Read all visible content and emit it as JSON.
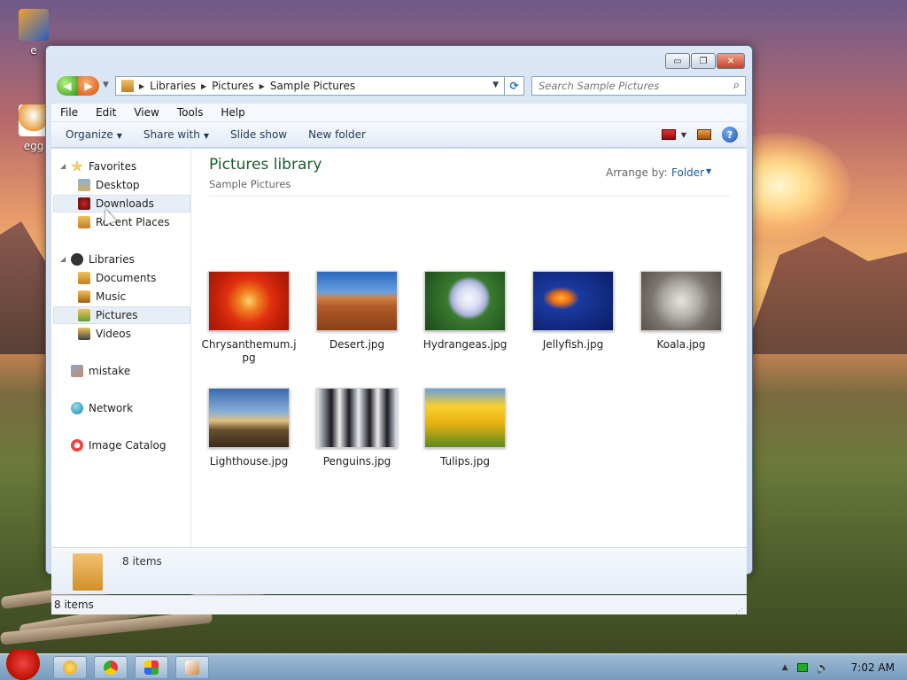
{
  "desktop": {
    "icons": [
      {
        "label": "e"
      },
      {
        "label": "egg"
      }
    ]
  },
  "window": {
    "controls": {
      "minimize": "▭",
      "maximize": "❐",
      "close": "✕"
    },
    "nav": {
      "back": "◀",
      "forward": "▶"
    },
    "address": {
      "breadcrumbs": [
        "Libraries",
        "Pictures",
        "Sample Pictures"
      ]
    },
    "search": {
      "placeholder": "Search Sample Pictures"
    },
    "menu": [
      "File",
      "Edit",
      "View",
      "Tools",
      "Help"
    ],
    "toolbar": {
      "organize": "Organize",
      "share_with": "Share with",
      "slide_show": "Slide show",
      "new_folder": "New folder",
      "help": "?"
    },
    "nav_pane": {
      "favorites": {
        "label": "Favorites",
        "items": [
          "Desktop",
          "Downloads",
          "Recent Places"
        ]
      },
      "libraries": {
        "label": "Libraries",
        "items": [
          "Documents",
          "Music",
          "Pictures",
          "Videos"
        ]
      },
      "mistake": "mistake",
      "network": "Network",
      "image_catalog": "Image Catalog"
    },
    "main": {
      "title": "Pictures library",
      "subtitle": "Sample Pictures",
      "arrange_label": "Arrange by:",
      "arrange_value": "Folder",
      "files": [
        {
          "name": "Chrysanthemum.jpg"
        },
        {
          "name": "Desert.jpg"
        },
        {
          "name": "Hydrangeas.jpg"
        },
        {
          "name": "Jellyfish.jpg"
        },
        {
          "name": "Koala.jpg"
        },
        {
          "name": "Lighthouse.jpg"
        },
        {
          "name": "Penguins.jpg"
        },
        {
          "name": "Tulips.jpg"
        }
      ]
    },
    "details": {
      "count": "8 items"
    },
    "status": {
      "text": "8 items"
    }
  },
  "taskbar": {
    "clock": "7:02 AM"
  },
  "colors": {
    "library_title": "#1e5a2e",
    "link_blue": "#1e5aa0",
    "selection": "#e8eef6"
  }
}
